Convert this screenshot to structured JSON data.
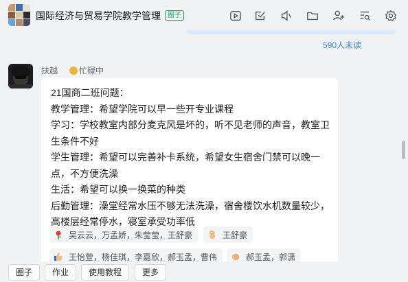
{
  "header": {
    "title": "国际经济与贸易学院教学管理",
    "tag": "圈子",
    "toolbar": [
      "video-icon",
      "task-check-icon",
      "announcement-icon",
      "folder-icon",
      "add-member-icon",
      "search-history-icon",
      "settings-icon"
    ]
  },
  "unread": {
    "label": "590人未读"
  },
  "message": {
    "sender": "扶越",
    "status": "忙碌中",
    "lines": [
      "21国商二班问题：",
      "教学管理：希望学院可以早一些开专业课程",
      "学习：学校教室内部分麦克风是坏的，听不见老师的声音，教室卫生条件不好",
      "学生管理：希望可以完善补卡系统，希望女生宿舍门禁可以晚一点，不方便洗澡",
      "生活：希望可以换一换菜的种类",
      "后勤管理：澡堂经常水压不够无法洗澡，宿舍楼饮水机数量较少，高楼层经常停水，寝室承受功率低"
    ],
    "reactions": [
      {
        "emoji": "rose-icon",
        "users": "吴云云，万孟娇，朱莹莹，王舒豪"
      },
      {
        "emoji": "ok-hand-icon",
        "users": "王舒豪"
      },
      {
        "emoji": "thumbs-up-icon",
        "users": "王怡萱，杨佳琪，李嘉欣，郝玉孟，曹伟"
      },
      {
        "emoji": "clap-icon",
        "users": "郝玉孟，郭潇"
      }
    ]
  },
  "quick_actions": [
    "圈子",
    "作业",
    "使用教程",
    "更多"
  ],
  "colors": {
    "accent": "#3a86e8",
    "tag_green": "#10a35a",
    "bubble": "#ffffff",
    "background": "#f1f2f4"
  }
}
